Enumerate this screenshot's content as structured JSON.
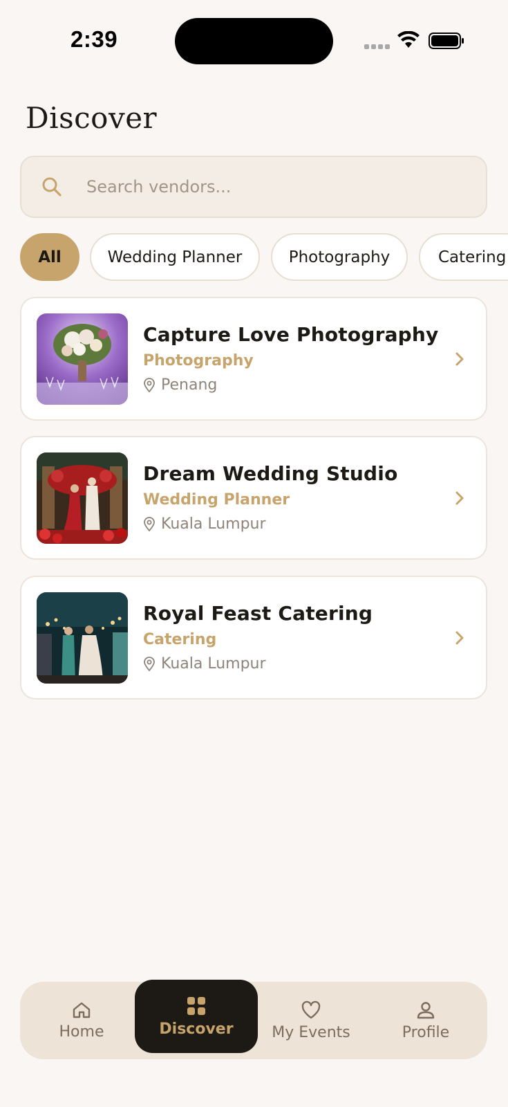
{
  "status_bar": {
    "time": "2:39"
  },
  "page": {
    "title": "Discover"
  },
  "search": {
    "placeholder": "Search vendors..."
  },
  "filters": [
    {
      "label": "All",
      "active": true
    },
    {
      "label": "Wedding Planner",
      "active": false
    },
    {
      "label": "Photography",
      "active": false
    },
    {
      "label": "Catering",
      "active": false
    }
  ],
  "vendors": [
    {
      "name": "Capture Love Photography",
      "category": "Photography",
      "location": "Penang"
    },
    {
      "name": "Dream Wedding Studio",
      "category": "Wedding Planner",
      "location": "Kuala Lumpur"
    },
    {
      "name": "Royal Feast Catering",
      "category": "Catering",
      "location": "Kuala Lumpur"
    }
  ],
  "nav": [
    {
      "label": "Home",
      "icon": "home-icon",
      "active": false
    },
    {
      "label": "Discover",
      "icon": "grid-icon",
      "active": true
    },
    {
      "label": "My Events",
      "icon": "heart-icon",
      "active": false
    },
    {
      "label": "Profile",
      "icon": "user-icon",
      "active": false
    }
  ],
  "colors": {
    "accent": "#c6a46b",
    "dark": "#1d1914",
    "background": "#f9f6f3"
  }
}
